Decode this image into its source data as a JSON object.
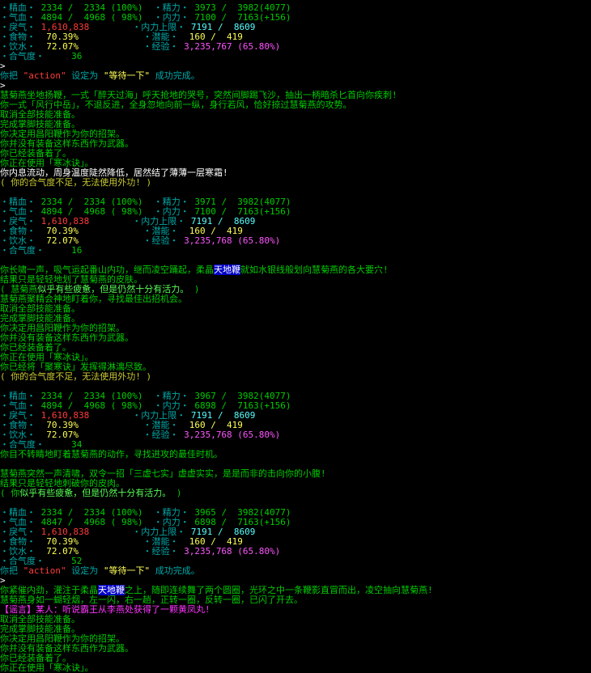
{
  "colors": {
    "label": "#00a8a8",
    "green": "#00cc00",
    "bright_green": "#55ff55",
    "white": "#ffffff",
    "yellow": "#ffff55",
    "olive": "#c8c832",
    "red": "#ff3b3b",
    "cyan": "#55ffff",
    "magenta": "#ff55ff",
    "bright_magenta": "#ff33ff"
  },
  "lines": [
    {
      "segs": [
        {
          "t": "・精血・ ",
          "c": "label"
        },
        {
          "t": "2334 /  2334 (100%)  ",
          "c": "green"
        },
        {
          "t": "・精力・ ",
          "c": "label"
        },
        {
          "t": "3973 /  3982(4077)",
          "c": "green"
        }
      ]
    },
    {
      "segs": [
        {
          "t": "・气血・ ",
          "c": "label"
        },
        {
          "t": "4894 /  4968 ( 98%)  ",
          "c": "green"
        },
        {
          "t": "・内力・ ",
          "c": "label"
        },
        {
          "t": "7100 /  7163(+156)",
          "c": "green"
        }
      ]
    },
    {
      "segs": [
        {
          "t": "・戾气・ ",
          "c": "label"
        },
        {
          "t": "1,610,838",
          "c": "red"
        },
        {
          "t": "        ・内力上限・ ",
          "c": "label"
        },
        {
          "t": "7191 /  8609",
          "c": "cyan"
        }
      ]
    },
    {
      "segs": [
        {
          "t": "・食物・ ",
          "c": "label"
        },
        {
          "t": " 70.39%",
          "c": "yellow"
        },
        {
          "t": "            ・潜能・ ",
          "c": "label"
        },
        {
          "t": " 160 /  419",
          "c": "yellow"
        }
      ]
    },
    {
      "segs": [
        {
          "t": "・饮水・ ",
          "c": "label"
        },
        {
          "t": " 72.07%",
          "c": "yellow"
        },
        {
          "t": "            ・经验・ ",
          "c": "label"
        },
        {
          "t": "3,235,767 (65.80%)",
          "c": "magenta"
        }
      ]
    },
    {
      "segs": [
        {
          "t": "・合气度・ ",
          "c": "label"
        },
        {
          "t": "    36",
          "c": "green"
        }
      ]
    },
    {
      "segs": [
        {
          "t": ">",
          "c": "white"
        }
      ]
    },
    {
      "segs": [
        {
          "t": "你把 ",
          "c": "label"
        },
        {
          "t": "\"action\"",
          "c": "red"
        },
        {
          "t": " 设定为 ",
          "c": "label"
        },
        {
          "t": "\"等待一下\"",
          "c": "yellow"
        },
        {
          "t": " 成功完成。",
          "c": "label"
        }
      ]
    },
    {
      "segs": [
        {
          "t": ">",
          "c": "white"
        }
      ]
    },
    {
      "segs": [
        {
          "t": "慧菊燕坐地扬鞭，一式「醉天过海」呼天抢地的哭号，突然间脚踢飞沙，抽出一柄暗杀匕首向你疾刺!",
          "c": "green"
        }
      ]
    },
    {
      "segs": [
        {
          "t": "你一式「风行中岳」，不退反进，全身忽地向前一纵，身行若风，恰好掠过慧菊燕的攻势。",
          "c": "green"
        }
      ]
    },
    {
      "segs": [
        {
          "t": "取消全部技能准备。",
          "c": "green"
        }
      ]
    },
    {
      "segs": [
        {
          "t": "完成掌脚技能准备。",
          "c": "green"
        }
      ]
    },
    {
      "segs": [
        {
          "t": "你决定用昌阳鞭作为你的招架。",
          "c": "green"
        }
      ]
    },
    {
      "segs": [
        {
          "t": "你并没有装备这样东西作为武器。",
          "c": "green"
        }
      ]
    },
    {
      "segs": [
        {
          "t": "你已经装备着了。",
          "c": "green"
        }
      ]
    },
    {
      "segs": [
        {
          "t": "你正在使用「寒冰诀」。",
          "c": "green"
        }
      ]
    },
    {
      "segs": [
        {
          "t": "你内息流动，周身温度陡然降低，居然结了薄薄一层寒霜!",
          "c": "white"
        }
      ]
    },
    {
      "segs": [
        {
          "t": "( 你的合气度不足，无法使用外功! )",
          "c": "olive"
        }
      ]
    },
    {
      "segs": []
    },
    {
      "segs": [
        {
          "t": "・精血・ ",
          "c": "label"
        },
        {
          "t": "2334 /  2334 (100%)  ",
          "c": "green"
        },
        {
          "t": "・精力・ ",
          "c": "label"
        },
        {
          "t": "3971 /  3982(4077)",
          "c": "green"
        }
      ]
    },
    {
      "segs": [
        {
          "t": "・气血・ ",
          "c": "label"
        },
        {
          "t": "4894 /  4968 ( 98%)  ",
          "c": "green"
        },
        {
          "t": "・内力・ ",
          "c": "label"
        },
        {
          "t": "7100 /  7163(+156)",
          "c": "green"
        }
      ]
    },
    {
      "segs": [
        {
          "t": "・戾气・ ",
          "c": "label"
        },
        {
          "t": "1,610,838",
          "c": "red"
        },
        {
          "t": "        ・内力上限・ ",
          "c": "label"
        },
        {
          "t": "7191 /  8609",
          "c": "cyan"
        }
      ]
    },
    {
      "segs": [
        {
          "t": "・食物・ ",
          "c": "label"
        },
        {
          "t": " 70.39%",
          "c": "yellow"
        },
        {
          "t": "            ・潜能・ ",
          "c": "label"
        },
        {
          "t": " 160 /  419",
          "c": "yellow"
        }
      ]
    },
    {
      "segs": [
        {
          "t": "・饮水・ ",
          "c": "label"
        },
        {
          "t": " 72.07%",
          "c": "yellow"
        },
        {
          "t": "            ・经验・ ",
          "c": "label"
        },
        {
          "t": "3,235,768 (65.80%)",
          "c": "magenta"
        }
      ]
    },
    {
      "segs": [
        {
          "t": "・合气度・ ",
          "c": "label"
        },
        {
          "t": "    16",
          "c": "green"
        }
      ]
    },
    {
      "segs": []
    },
    {
      "segs": [
        {
          "t": "你长啸一声，吸气运起番山内功，继而凌空踊起，柔晶",
          "c": "green"
        },
        {
          "t": "天地鞭",
          "c": "white",
          "hl": true
        },
        {
          "t": "就如水银线般划向慧菊燕的各大要穴!",
          "c": "green"
        }
      ]
    },
    {
      "segs": [
        {
          "t": "结果只是轻轻地划了慧菊燕的皮肤。",
          "c": "green"
        }
      ]
    },
    {
      "segs": [
        {
          "t": "( 慧菊燕",
          "c": "green"
        },
        {
          "t": "似乎有些疲惫，但是仍然十分有活力。",
          "c": "bright_green"
        },
        {
          "t": " )",
          "c": "green"
        }
      ]
    },
    {
      "segs": [
        {
          "t": "慧菊燕聚精会神地盯着你，寻找最佳出招机会。",
          "c": "green"
        }
      ]
    },
    {
      "segs": [
        {
          "t": "取消全部技能准备。",
          "c": "green"
        }
      ]
    },
    {
      "segs": [
        {
          "t": "完成掌脚技能准备。",
          "c": "green"
        }
      ]
    },
    {
      "segs": [
        {
          "t": "你决定用昌阳鞭作为你的招架。",
          "c": "green"
        }
      ]
    },
    {
      "segs": [
        {
          "t": "你并没有装备这样东西作为武器。",
          "c": "green"
        }
      ]
    },
    {
      "segs": [
        {
          "t": "你已经装备着了。",
          "c": "green"
        }
      ]
    },
    {
      "segs": [
        {
          "t": "你正在使用「寒冰诀」。",
          "c": "green"
        }
      ]
    },
    {
      "segs": [
        {
          "t": "你已经将「聚寒诀」发挥得淋漓尽致。",
          "c": "green"
        }
      ]
    },
    {
      "segs": [
        {
          "t": "( 你的合气度不足，无法使用外功! )",
          "c": "olive"
        }
      ]
    },
    {
      "segs": []
    },
    {
      "segs": [
        {
          "t": "・精血・ ",
          "c": "label"
        },
        {
          "t": "2334 /  2334 (100%)  ",
          "c": "green"
        },
        {
          "t": "・精力・ ",
          "c": "label"
        },
        {
          "t": "3967 /  3982(4077)",
          "c": "green"
        }
      ]
    },
    {
      "segs": [
        {
          "t": "・气血・ ",
          "c": "label"
        },
        {
          "t": "4894 /  4968 ( 98%)  ",
          "c": "green"
        },
        {
          "t": "・内力・ ",
          "c": "label"
        },
        {
          "t": "6898 /  7163(+156)",
          "c": "green"
        }
      ]
    },
    {
      "segs": [
        {
          "t": "・戾气・ ",
          "c": "label"
        },
        {
          "t": "1,610,838",
          "c": "red"
        },
        {
          "t": "        ・内力上限・ ",
          "c": "label"
        },
        {
          "t": "7191 /  8609",
          "c": "cyan"
        }
      ]
    },
    {
      "segs": [
        {
          "t": "・食物・ ",
          "c": "label"
        },
        {
          "t": " 70.39%",
          "c": "yellow"
        },
        {
          "t": "            ・潜能・ ",
          "c": "label"
        },
        {
          "t": " 160 /  419",
          "c": "yellow"
        }
      ]
    },
    {
      "segs": [
        {
          "t": "・饮水・ ",
          "c": "label"
        },
        {
          "t": " 72.07%",
          "c": "yellow"
        },
        {
          "t": "            ・经验・ ",
          "c": "label"
        },
        {
          "t": "3,235,768 (65.80%)",
          "c": "magenta"
        }
      ]
    },
    {
      "segs": [
        {
          "t": "・合气度・ ",
          "c": "label"
        },
        {
          "t": "    34",
          "c": "green"
        }
      ]
    },
    {
      "segs": [
        {
          "t": "你目不转睛地盯着慧菊燕的动作，寻找进攻的最佳时机。",
          "c": "green"
        }
      ]
    },
    {
      "segs": []
    },
    {
      "segs": [
        {
          "t": "慧菊燕突然一声清啸，双令一招「三虚七实」虚虚实实，是是而非的击向你的小腹!",
          "c": "green"
        }
      ]
    },
    {
      "segs": [
        {
          "t": "结果只是轻轻地刺破你的皮肉。",
          "c": "green"
        }
      ]
    },
    {
      "segs": [
        {
          "t": "( 你",
          "c": "green"
        },
        {
          "t": "似乎有些疲惫，但是仍然十分有活力。",
          "c": "bright_green"
        },
        {
          "t": " )",
          "c": "green"
        }
      ]
    },
    {
      "segs": []
    },
    {
      "segs": [
        {
          "t": "・精血・ ",
          "c": "label"
        },
        {
          "t": "2334 /  2334 (100%)  ",
          "c": "green"
        },
        {
          "t": "・精力・ ",
          "c": "label"
        },
        {
          "t": "3965 /  3982(4077)",
          "c": "green"
        }
      ]
    },
    {
      "segs": [
        {
          "t": "・气血・ ",
          "c": "label"
        },
        {
          "t": "4847 /  4968 ( 98%)  ",
          "c": "green"
        },
        {
          "t": "・内力・ ",
          "c": "label"
        },
        {
          "t": "6898 /  7163(+156)",
          "c": "green"
        }
      ]
    },
    {
      "segs": [
        {
          "t": "・戾气・ ",
          "c": "label"
        },
        {
          "t": "1,610,838",
          "c": "red"
        },
        {
          "t": "        ・内力上限・ ",
          "c": "label"
        },
        {
          "t": "7191 /  8609",
          "c": "cyan"
        }
      ]
    },
    {
      "segs": [
        {
          "t": "・食物・ ",
          "c": "label"
        },
        {
          "t": " 70.39%",
          "c": "yellow"
        },
        {
          "t": "            ・潜能・ ",
          "c": "label"
        },
        {
          "t": " 160 /  419",
          "c": "yellow"
        }
      ]
    },
    {
      "segs": [
        {
          "t": "・饮水・ ",
          "c": "label"
        },
        {
          "t": " 72.07%",
          "c": "yellow"
        },
        {
          "t": "            ・经验・ ",
          "c": "label"
        },
        {
          "t": "3,235,768 (65.80%)",
          "c": "magenta"
        }
      ]
    },
    {
      "segs": [
        {
          "t": "・合气度・ ",
          "c": "label"
        },
        {
          "t": "    52",
          "c": "green"
        }
      ]
    },
    {
      "segs": [
        {
          "t": "你把 ",
          "c": "label"
        },
        {
          "t": "\"action\"",
          "c": "red"
        },
        {
          "t": " 设定为 ",
          "c": "label"
        },
        {
          "t": "\"等待一下\"",
          "c": "yellow"
        },
        {
          "t": " 成功完成。",
          "c": "label"
        }
      ]
    },
    {
      "segs": [
        {
          "t": ">",
          "c": "white"
        }
      ]
    },
    {
      "segs": [
        {
          "t": "你紧催内劲，灌注于柔晶",
          "c": "green"
        },
        {
          "t": "天地鞭",
          "c": "white",
          "hl": true
        },
        {
          "t": "之上，随即连续舞了两个圆圈，光环之中一条鞭影直冒而出，凌空抽向慧菊燕!",
          "c": "green"
        }
      ]
    },
    {
      "segs": [
        {
          "t": "慧菊燕身如一蝴轻烟，左一闪，右一趟，正转一圈，反转一圈，已闪了开去。",
          "c": "green"
        }
      ]
    },
    {
      "segs": [
        {
          "t": "【谣言】某人：听说霸王从李燕处获得了一颗黄凤丸!",
          "c": "bright_magenta"
        }
      ]
    },
    {
      "segs": [
        {
          "t": "取消全部技能准备。",
          "c": "green"
        }
      ]
    },
    {
      "segs": [
        {
          "t": "完成掌脚技能准备。",
          "c": "green"
        }
      ]
    },
    {
      "segs": [
        {
          "t": "你决定用昌阳鞭作为你的招架。",
          "c": "green"
        }
      ]
    },
    {
      "segs": [
        {
          "t": "你并没有装备这样东西作为武器。",
          "c": "green"
        }
      ]
    },
    {
      "segs": [
        {
          "t": "你已经装备着了。",
          "c": "green"
        }
      ]
    },
    {
      "segs": [
        {
          "t": "你正在使用「寒冰诀」。",
          "c": "green"
        }
      ]
    }
  ]
}
